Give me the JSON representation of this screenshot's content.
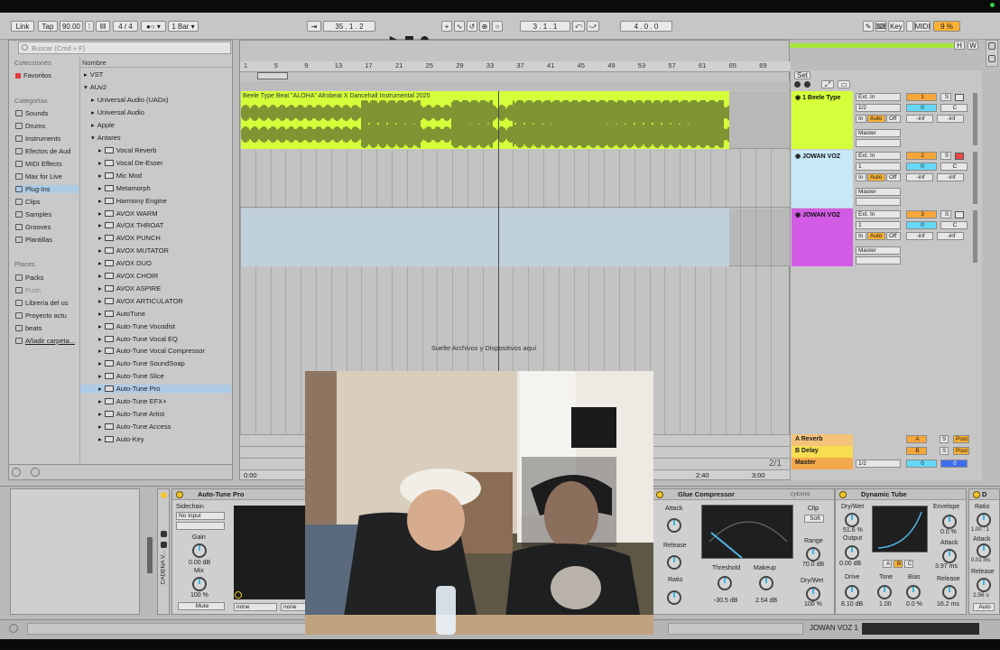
{
  "colors": {
    "track1": "#d4ff3a",
    "track2": "#c7e8f7",
    "track3": "#d25ce6",
    "clip3": "#c1d1db",
    "accent_orange": "#f8b035",
    "accent_cyan": "#65d8f7",
    "selection": "#aecbe6"
  },
  "transport": {
    "link": "Link",
    "tap": "Tap",
    "tempo": "90.00",
    "signature": "4 / 4",
    "quantize": "1 Bar",
    "position": "35 .  1 .  2",
    "loop_start": "3 .  1 .  1",
    "loop_length": "4 .  0 .  0",
    "key": "Key",
    "midi": "MIDI",
    "cpu": "9 %",
    "h": "H",
    "w": "W"
  },
  "browser": {
    "search_placeholder": "Buscar (Cmd + F)",
    "collections_header": "Colecciones",
    "favorites": "Favoritos",
    "categories_header": "Categorías",
    "categories": [
      "Sounds",
      "Drums",
      "Instruments",
      "Efectos de Aud",
      "MIDI Effects",
      "Max for Live",
      "Plug-Ins",
      "Clips",
      "Samples",
      "Grooves",
      "Plantillas"
    ],
    "places_header": "Places",
    "places": [
      "Packs",
      "Push",
      "Librería del us",
      "Proyecto actu",
      "beats",
      "Añadir carpeta..."
    ],
    "name_header": "Nombre",
    "tree": {
      "vst": "VST",
      "auv2": "AUv2",
      "uadx": "Universal Audio (UADx)",
      "ua": "Universal Audio",
      "apple": "Apple",
      "antares": "Antares"
    },
    "plugins": [
      "Vocal Reverb",
      "Vocal De-Esser",
      "Mic Mod",
      "Metamorph",
      "Harmony Engine",
      "AVOX WARM",
      "AVOX THROAT",
      "AVOX PUNCH",
      "AVOX MUTATOR",
      "AVOX DUO",
      "AVOX CHOIR",
      "AVOX ASPIRE",
      "AVOX ARTICULATOR",
      "AutoTune",
      "Auto-Tune Vocodist",
      "Auto-Tune Vocal EQ",
      "Auto-Tune Vocal Compressor",
      "Auto-Tune SoundSoap",
      "Auto-Tune Slice",
      "Auto-Tune Pro",
      "Auto-Tune EFX+",
      "Auto-Tune Artist",
      "Auto-Tune Access",
      "Auto-Key"
    ],
    "selected_plugin": "Auto-Tune Pro"
  },
  "arrangement": {
    "ruler": [
      "1",
      "5",
      "9",
      "13",
      "17",
      "21",
      "25",
      "29",
      "33",
      "37",
      "41",
      "45",
      "49",
      "53",
      "57",
      "61",
      "65",
      "69"
    ],
    "clip_title": "Beele Type Beat \"ALOHA\" Afrobeat X Dancehall Instrumental 2025",
    "drop_hint": "Suelte Archivos y Dispositivos aquí",
    "time_ruler": [
      "0:00",
      "2:40",
      "3:00"
    ],
    "page": "2/1",
    "set_label": "Set"
  },
  "tracks": [
    {
      "name": "1 Beele Type",
      "input": "Ext. In",
      "channel": "1/2",
      "monitor_in": "In",
      "monitor_auto": "Auto",
      "monitor_off": "Off",
      "out": "Master",
      "num": "1",
      "vol": "0",
      "pan": "C",
      "send_a": "-inf",
      "send_b": "-inf",
      "s": "S"
    },
    {
      "name": "JOWAN VOZ",
      "input": "Ext. In",
      "channel": "1",
      "monitor_in": "In",
      "monitor_auto": "Auto",
      "monitor_off": "Off",
      "out": "Master",
      "num": "2",
      "vol": "0",
      "pan": "C",
      "send_a": "-inf",
      "send_b": "-inf",
      "s": "S"
    },
    {
      "name": "JOWAN VOZ",
      "input": "Ext. In",
      "channel": "1",
      "monitor_in": "In",
      "monitor_auto": "Auto",
      "monitor_off": "Off",
      "out": "Master",
      "num": "3",
      "vol": "0",
      "pan": "C",
      "send_a": "-inf",
      "send_b": "-inf",
      "s": "S"
    }
  ],
  "returns": [
    {
      "name": "A Reverb",
      "letter": "A",
      "s": "S",
      "post": "Post"
    },
    {
      "name": "B Delay",
      "letter": "B",
      "s": "S",
      "post": "Post"
    },
    {
      "name": "Master",
      "channel": "1/2",
      "vol": "0",
      "pan": "0"
    }
  ],
  "devices": {
    "chain_label": "CADENA V...",
    "autotune": {
      "title": "Auto-Tune Pro",
      "sidechain": "Sidechain",
      "no_input": "No Input",
      "gain": "Gain",
      "gain_val": "0.00 dB",
      "mix": "Mix",
      "mix_val": "100 %",
      "mute": "Mute",
      "none1": "none",
      "none2": "none"
    },
    "glue": {
      "title": "Glue Compressor",
      "brand": "cytomic",
      "attack": "Attack",
      "attack_scale": [
        ".1",
        ".3",
        "1",
        "3",
        "10",
        "30"
      ],
      "release": "Release",
      "release_scale": [
        ".1",
        ".2",
        ".4",
        ".6",
        "1.2",
        "A"
      ],
      "ratio": "Ratio",
      "ratio_scale": [
        "2",
        "4",
        "10"
      ],
      "meter_scale": [
        "0",
        "5",
        "10",
        "15",
        "20"
      ],
      "threshold": "Threshold",
      "threshold_val": "-30.5 dB",
      "makeup": "Makeup",
      "makeup_val": "2.54 dB",
      "clip": "Clip",
      "soft": "Soft",
      "range": "Range",
      "range_val": "70.0 dB",
      "drywet": "Dry/Wet",
      "drywet_val": "100 %"
    },
    "tube": {
      "title": "Dynamic Tube",
      "drywet": "Dry/Wet",
      "drywet_val": "51.6 %",
      "output": "Output",
      "output_val": "0.00 dB",
      "drive": "Drive",
      "drive_val": "8.10 dB",
      "tone": "Tone",
      "tone_val": "1.00",
      "bias": "Bias",
      "bias_val": "0.0 %",
      "envelope": "Envelope",
      "envelope_val": "0.0 %",
      "attack": "Attack",
      "attack_val": "3.97 ms",
      "release": "Release",
      "release_val": "16.2 ms",
      "a": "A",
      "b": "B",
      "c": "C"
    },
    "next": {
      "title": "D",
      "ratio": "Ratio",
      "ratio_val": "1.00 : 1",
      "attack": "Attack",
      "attack_val": "0.01 ms",
      "release": "Release",
      "release_val": "2.56 s",
      "auto": "Auto"
    }
  },
  "status": {
    "track": "JOWAN VOZ 1"
  }
}
